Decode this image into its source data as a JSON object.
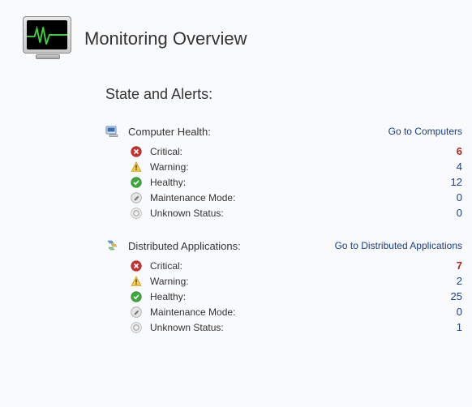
{
  "page": {
    "title": "Monitoring Overview",
    "section_heading": "State and Alerts:"
  },
  "sections": [
    {
      "title": "Computer Health:",
      "link_label": "Go to Computers",
      "rows": [
        {
          "kind": "critical",
          "label": "Critical:",
          "value": "6"
        },
        {
          "kind": "warning",
          "label": "Warning:",
          "value": "4"
        },
        {
          "kind": "healthy",
          "label": "Healthy:",
          "value": "12"
        },
        {
          "kind": "maintenance",
          "label": "Maintenance Mode:",
          "value": "0"
        },
        {
          "kind": "unknown",
          "label": "Unknown Status:",
          "value": "0"
        }
      ]
    },
    {
      "title": "Distributed Applications:",
      "link_label": "Go to Distributed Applications",
      "rows": [
        {
          "kind": "critical",
          "label": "Critical:",
          "value": "7"
        },
        {
          "kind": "warning",
          "label": "Warning:",
          "value": "2"
        },
        {
          "kind": "healthy",
          "label": "Healthy:",
          "value": "25"
        },
        {
          "kind": "maintenance",
          "label": "Maintenance Mode:",
          "value": "0"
        },
        {
          "kind": "unknown",
          "label": "Unknown Status:",
          "value": "1"
        }
      ]
    }
  ]
}
